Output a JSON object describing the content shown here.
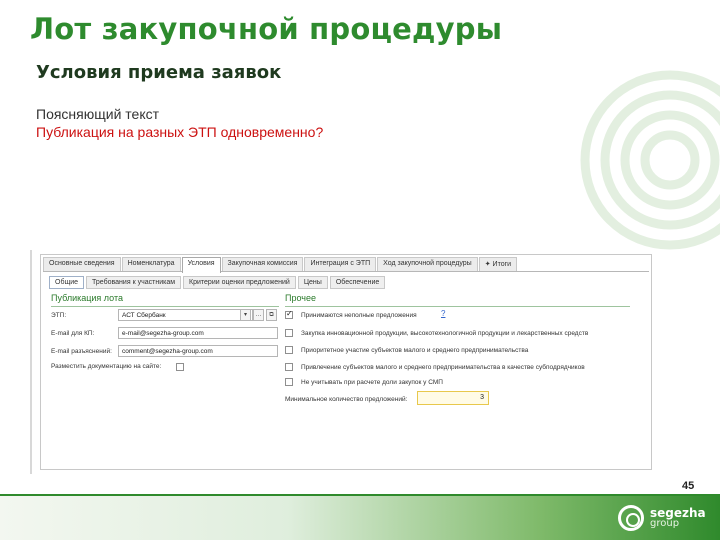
{
  "slide": {
    "title": "Лот закупочной процедуры",
    "subtitle": "Условия приема заявок",
    "explain": "Поясняющий текст",
    "explain_red": "Публикация на разных ЭТП одновременно?",
    "page_number": "45"
  },
  "form": {
    "tabs_main": [
      "Основные сведения",
      "Номенклатура",
      "Условия",
      "Закупочная комиссия",
      "Интеграция с ЭТП",
      "Ход закупочной процедуры",
      "Итоги"
    ],
    "tabs_main_active": "Условия",
    "tabs_sub": [
      "Общие",
      "Требования к участникам",
      "Критерии оценки предложений",
      "Цены",
      "Обеспечение"
    ],
    "tabs_sub_active": "Общие",
    "publication": {
      "title": "Публикация лота",
      "etp_label": "ЭТП:",
      "etp_value": "АСТ Сбербанк",
      "email_kp_label": "E-mail для КП:",
      "email_kp_value": "e-mail@segezha-group.com",
      "email_expl_label": "E-mail разъяснений:",
      "email_expl_value": "comment@segezha-group.com",
      "post_docs_label": "Разместить документацию на сайте:"
    },
    "other": {
      "title": "Прочее",
      "items": [
        {
          "label": "Принимаются неполные предложения",
          "checked": true
        },
        {
          "label": "Закупка инновационной продукции, высокотехнологичной продукции и лекарственных средств",
          "checked": false
        },
        {
          "label": "Приоритетное участие субъектов малого и среднего предпринимательства",
          "checked": false
        },
        {
          "label": "Привлечение субъектов малого и среднего предпринимательства в качестве субподрядчиков",
          "checked": false
        },
        {
          "label": "Не учитывать при расчете доли закупок у СМП",
          "checked": false
        }
      ],
      "help": "?",
      "min_offers_label": "Минимальное количество предложений:",
      "min_offers_value": "3"
    }
  },
  "logo": {
    "name": "segezha",
    "sub": "group"
  },
  "colors": {
    "title_green": "#2e8b2e",
    "accent_red": "#cc1111",
    "brand_dark_green": "#2f8a2c"
  }
}
